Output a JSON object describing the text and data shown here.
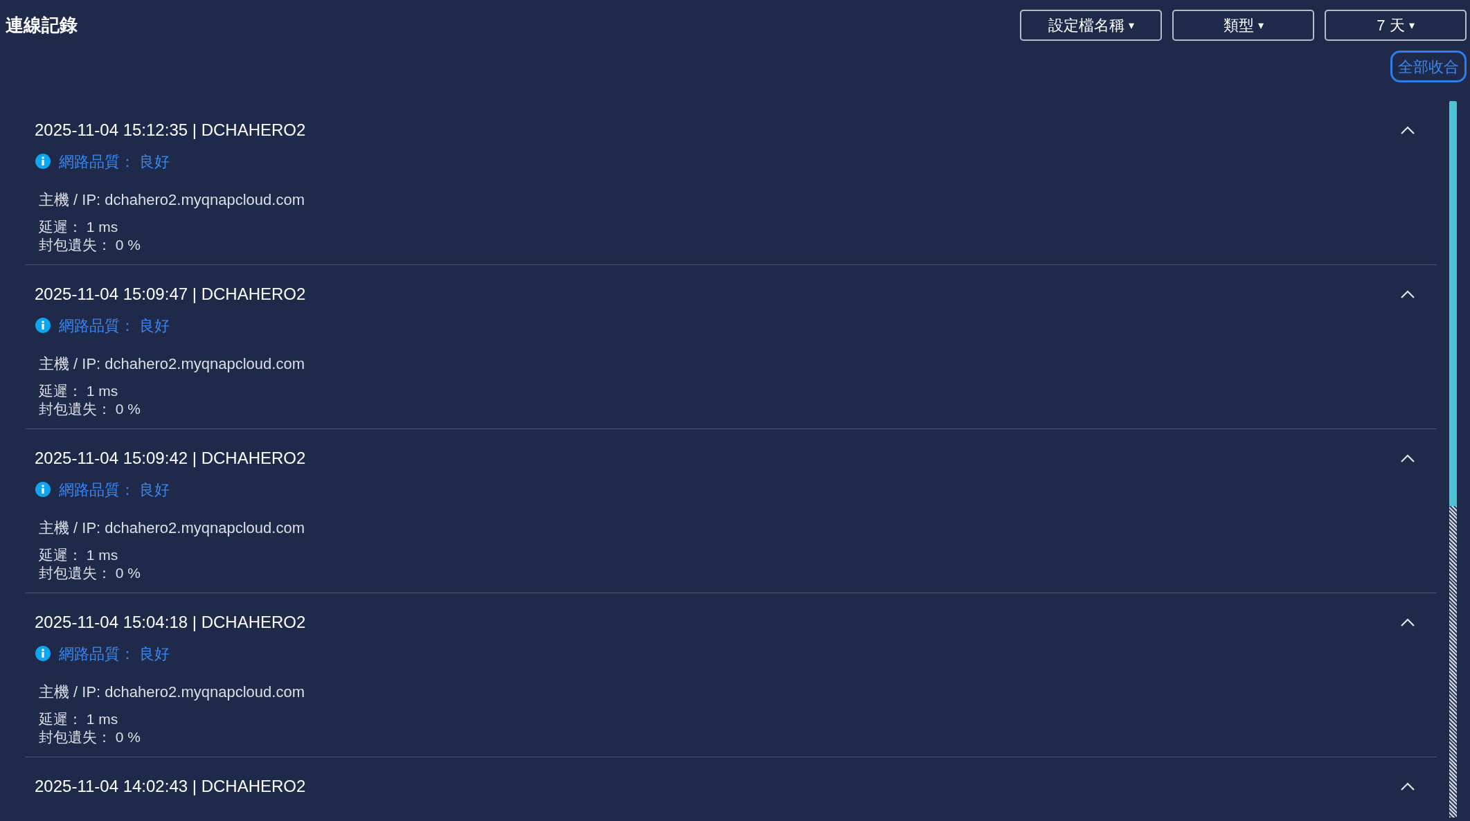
{
  "title": "連線記錄",
  "filters": [
    {
      "label": "設定檔名稱",
      "caret": "▾"
    },
    {
      "label": "類型",
      "caret": "▾"
    },
    {
      "label": "7 天",
      "caret": "▾"
    }
  ],
  "collapse_all_button": "全部收合",
  "entries": [
    {
      "header": "2025-11-04 15:12:35 | DCHAHERO2",
      "expanded": true,
      "quality": "網路品質： 良好",
      "host": "主機 / IP: dchahero2.myqnapcloud.com",
      "latency": "延遲： 1 ms",
      "packet_loss": "封包遺失： 0 %"
    },
    {
      "header": "2025-11-04 15:09:47 | DCHAHERO2",
      "expanded": true,
      "quality": "網路品質： 良好",
      "host": "主機 / IP: dchahero2.myqnapcloud.com",
      "latency": "延遲： 1 ms",
      "packet_loss": "封包遺失： 0 %"
    },
    {
      "header": "2025-11-04 15:09:42 | DCHAHERO2",
      "expanded": true,
      "quality": "網路品質： 良好",
      "host": "主機 / IP: dchahero2.myqnapcloud.com",
      "latency": "延遲： 1 ms",
      "packet_loss": "封包遺失： 0 %"
    },
    {
      "header": "2025-11-04 15:04:18 | DCHAHERO2",
      "expanded": true,
      "quality": "網路品質： 良好",
      "host": "主機 / IP: dchahero2.myqnapcloud.com",
      "latency": "延遲： 1 ms",
      "packet_loss": "封包遺失： 0 %"
    },
    {
      "header": "2025-11-04 14:02:43 | DCHAHERO2",
      "expanded": true
    }
  ]
}
